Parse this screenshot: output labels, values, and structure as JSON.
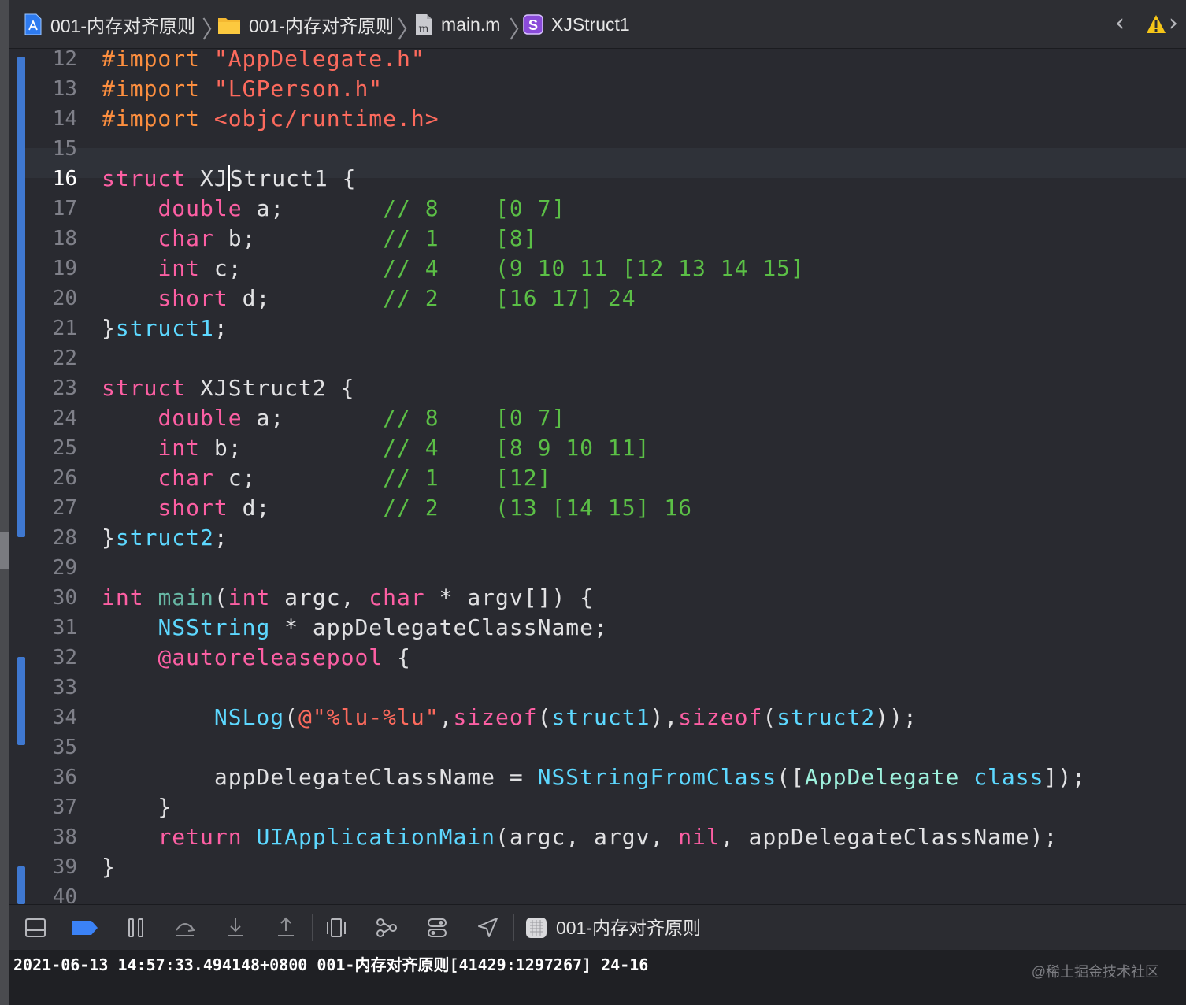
{
  "breadcrumbs": [
    {
      "label": "001-内存对齐原则",
      "icon": "xcode-project-icon"
    },
    {
      "label": "001-内存对齐原则",
      "icon": "folder-icon"
    },
    {
      "label": "main.m",
      "icon": "objc-file-icon"
    },
    {
      "label": "XJStruct1",
      "icon": "struct-symbol-icon"
    }
  ],
  "struct_badge": "S",
  "file_badge": "m",
  "nav": {
    "back": "‹",
    "forward": "›"
  },
  "editor": {
    "current_line": 16,
    "line_numbers": [
      "12",
      "13",
      "14",
      "15",
      "16",
      "17",
      "18",
      "19",
      "20",
      "21",
      "22",
      "23",
      "24",
      "25",
      "26",
      "27",
      "28",
      "29",
      "30",
      "31",
      "32",
      "33",
      "34",
      "35",
      "36",
      "37",
      "38",
      "39",
      "40"
    ],
    "code_lines": [
      "#import \"AppDelegate.h\"",
      "#import \"LGPerson.h\"",
      "#import <objc/runtime.h>",
      "",
      "struct XJStruct1 {",
      "    double a;       // 8    [0 7]",
      "    char b;         // 1    [8]",
      "    int c;          // 4    (9 10 11 [12 13 14 15]",
      "    short d;        // 2    [16 17] 24",
      "}struct1;",
      "",
      "struct XJStruct2 {",
      "    double a;       // 8    [0 7]",
      "    int b;          // 4    [8 9 10 11]",
      "    char c;         // 1    [12]",
      "    short d;        // 2    (13 [14 15] 16",
      "}struct2;",
      "",
      "int main(int argc, char * argv[]) {",
      "    NSString * appDelegateClassName;",
      "    @autoreleasepool {",
      "",
      "        NSLog(@\"%lu-%lu\",sizeof(struct1),sizeof(struct2));",
      "",
      "        appDelegateClassName = NSStringFromClass([AppDelegate class]);",
      "    }",
      "    return UIApplicationMain(argc, argv, nil, appDelegateClassName);",
      "}",
      ""
    ]
  },
  "debug_toolbar": {
    "buttons": [
      "hide-debug-area-icon",
      "breakpoints-toggle-icon",
      "pause-icon",
      "step-over-icon",
      "step-into-icon",
      "step-out-icon",
      "view-hierarchy-icon",
      "memory-graph-icon",
      "environment-overrides-icon",
      "location-icon"
    ],
    "scheme": "001-内存对齐原则"
  },
  "console": {
    "output": "2021-06-13 14:57:33.494148+0800 001-内存对齐原则[41429:1297267] 24-16"
  },
  "watermark": "@稀土掘金技术社区",
  "colors": {
    "background": "#292a30",
    "keyword": "#fc5fa3",
    "preprocessor": "#fd8f3f",
    "string": "#fc6a5d",
    "comment": "#5bbf46",
    "type": "#5dd8ff",
    "change_bar": "#3f78d0",
    "warning": "#f5c518"
  }
}
